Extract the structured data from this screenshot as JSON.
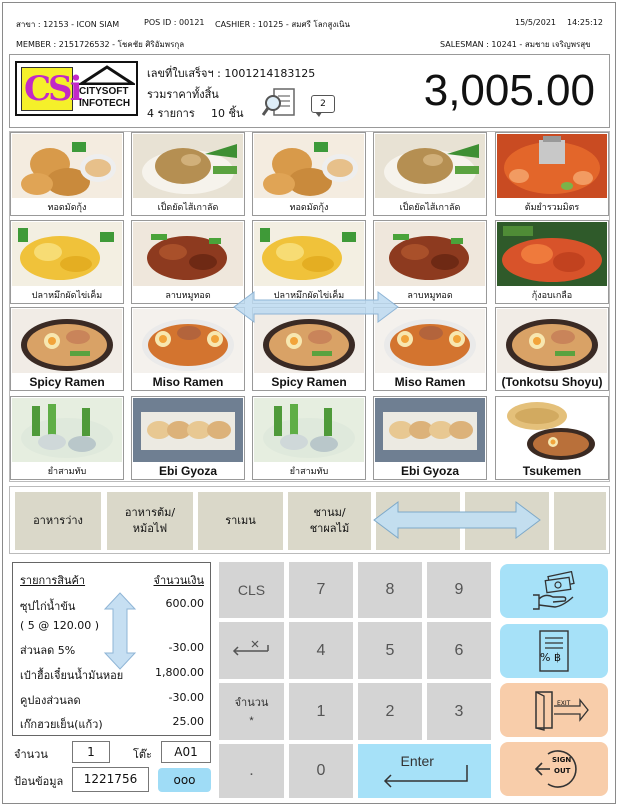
{
  "header": {
    "branch": "สาขา : 12153 - ICON SIAM",
    "pos_id": "POS ID : 00121",
    "cashier": "CASHIER : 10125 - สมศรี โลกสูงเนิน",
    "date": "15/5/2021",
    "time": "14:25:12",
    "member": "MEMBER : 2151726532 - โชคชัย ศิริอัมพรกุล",
    "salesman": "SALESMAN : 10241 - สมชาย เจริญพรสุข"
  },
  "logo": {
    "mark": "CSi",
    "line1": "CITYSOFT",
    "line2": "INFOTECH"
  },
  "summary": {
    "receipt_no": "เลขที่ใบเสร็จฯ : 1001214183125",
    "total_label": "รวมราคาทั้งสิ้น",
    "items_count": "4 รายการ",
    "pieces_count": "10 ชิ้น",
    "notification_count": "2",
    "total_amount": "3,005.00"
  },
  "menu_items": [
    {
      "label": "ทอดมัดกุ้ง",
      "img": "shrimp"
    },
    {
      "label": "เป็ดยัดไส้เกาลัด",
      "img": "duck"
    },
    {
      "label": "ทอดมัดกุ้ง",
      "img": "shrimp"
    },
    {
      "label": "เป็ดยัดไส้เกาลัด",
      "img": "duck"
    },
    {
      "label": "ต้มยำรวมมิตร",
      "img": "tomyum"
    },
    {
      "label": "ปลาหมึกผัดไข่เค็ม",
      "img": "squid"
    },
    {
      "label": "ลาบหมูทอด",
      "img": "pork"
    },
    {
      "label": "ปลาหมึกผัดไข่เค็ม",
      "img": "squid"
    },
    {
      "label": "ลาบหมูทอด",
      "img": "pork"
    },
    {
      "label": "กุ้งอบเกลือ",
      "img": "prawn"
    },
    {
      "label": "Spicy Ramen",
      "img": "ramen"
    },
    {
      "label": "Miso Ramen",
      "img": "misoramen"
    },
    {
      "label": "Spicy Ramen",
      "img": "ramen"
    },
    {
      "label": "Miso Ramen",
      "img": "misoramen"
    },
    {
      "label": "(Tonkotsu Shoyu)",
      "img": "ramen"
    },
    {
      "label": "ยำสามทับ",
      "img": "salad"
    },
    {
      "label": "Ebi Gyoza",
      "img": "gyoza"
    },
    {
      "label": "ยำสามทับ",
      "img": "salad"
    },
    {
      "label": "Ebi Gyoza",
      "img": "gyoza"
    },
    {
      "label": "Tsukemen",
      "img": "tsukemen"
    }
  ],
  "categories": [
    "อาหารว่าง",
    "อาหารต้ม/\nหม้อไฟ",
    "ราเมน",
    "ชานม/\nชาผลไม้",
    "",
    "",
    ""
  ],
  "receipt": {
    "col_item": "รายการสินค้า",
    "col_amount": "จำนวนเงิน",
    "lines": [
      {
        "name": "ซุปไก่น้ำข้น",
        "amount": "600.00"
      },
      {
        "name": "( 5 @ 120.00 )",
        "amount": ""
      },
      {
        "name": "ส่วนลด 5%",
        "amount": "-30.00"
      },
      {
        "name": "เป๋าฮื้อเจี๋ยนน้ำมันหอย",
        "amount": "1,800.00"
      },
      {
        "name": "คูปองส่วนลด",
        "amount": "-30.00"
      },
      {
        "name": "เก๊กฮวยเย็น(แก้ว)",
        "amount": "25.00"
      }
    ]
  },
  "inputs": {
    "qty_label": "จำนวน",
    "qty_value": "1",
    "table_label": "โต๊ะ",
    "table_value": "A01",
    "data_label": "ป้อนข้อมูล",
    "data_value": "1221756",
    "more_label": "ooo"
  },
  "keypad": {
    "cls": "CLS",
    "k7": "7",
    "k8": "8",
    "k9": "9",
    "k4": "4",
    "k5": "5",
    "k6": "6",
    "qty": "จำนวน\n*",
    "k1": "1",
    "k2": "2",
    "k3": "3",
    "dot": ".",
    "k0": "0",
    "enter": "Enter"
  },
  "actions": {
    "exit_text": "EXIT",
    "signout_line1": "SIGN",
    "signout_line2": "OUT",
    "percent_baht": "% ฿"
  },
  "colors": {
    "key_gray": "#d4d4d4",
    "action_blue": "#a6e1f8",
    "action_peach": "#f8cdaa",
    "category_bg": "#dad8c9",
    "logo_yellow": "#f5f02a",
    "logo_magenta": "#c229c6"
  }
}
